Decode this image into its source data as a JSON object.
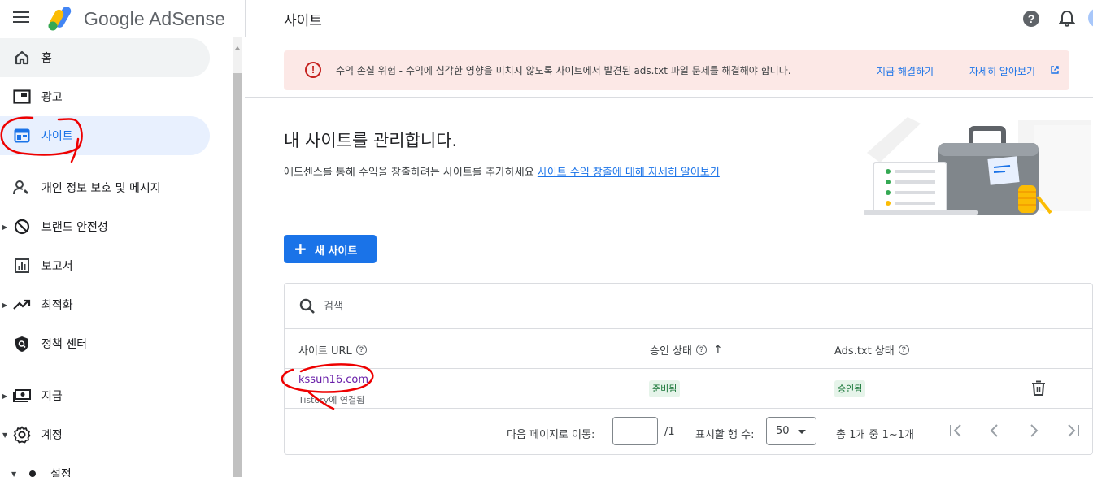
{
  "header": {
    "brand": "Google AdSense",
    "page_title": "사이트",
    "help_symbol": "?"
  },
  "sidebar": {
    "items": [
      {
        "label": "홈",
        "icon": "home-icon"
      },
      {
        "label": "광고",
        "icon": "ads-icon"
      },
      {
        "label": "사이트",
        "icon": "sites-icon",
        "active": true
      },
      {
        "label": "개인 정보 보호 및 메시지",
        "icon": "privacy-icon"
      },
      {
        "label": "브랜드 안전성",
        "icon": "brand-safety-icon"
      },
      {
        "label": "보고서",
        "icon": "reports-icon"
      },
      {
        "label": "최적화",
        "icon": "optimization-icon"
      },
      {
        "label": "정책 센터",
        "icon": "policy-icon"
      },
      {
        "label": "지급",
        "icon": "payments-icon"
      },
      {
        "label": "계정",
        "icon": "gear-icon"
      },
      {
        "label": "설정",
        "icon": "dot-icon"
      }
    ]
  },
  "alert": {
    "icon_symbol": "!",
    "message": "수익 손실 위험 - 수익에 심각한 영향을 미치지 않도록 사이트에서 발견된 ads.txt 파일 문제를 해결해야 합니다.",
    "fix_label": "지금 해결하기",
    "learn_label": "자세히 알아보기",
    "color": "#fce8e6"
  },
  "hero": {
    "title": "내 사이트를 관리합니다.",
    "subtitle": "애드센스를 통해 수익을 창출하려는 사이트를 추가하세요",
    "link": "사이트 수익 창출에 대해 자세히 알아보기"
  },
  "new_site_button": {
    "plus": "+",
    "label": "새 사이트"
  },
  "table": {
    "search_placeholder": "검색",
    "columns": [
      {
        "label": "사이트 URL"
      },
      {
        "label": "승인 상태"
      },
      {
        "label": "Ads.txt 상태"
      }
    ],
    "rows": [
      {
        "url": "kssun16.com",
        "subtitle": "Tistory에 연결됨",
        "approval": "준비됨",
        "ads_txt": "승인됨"
      }
    ],
    "help_symbol": "?",
    "sort_arrow": "↑"
  },
  "pagination": {
    "goto_label": "다음 페이지로 이동:",
    "page_value": "",
    "of_label": "/1",
    "rows_label": "표시할 행 수:",
    "rows_value": "50",
    "total_label": "총 1개 중 1~1개"
  },
  "colors": {
    "accent": "#1a73e8",
    "active_nav_bg": "#e8f0fe",
    "chip_bg": "#e6f4ea",
    "chip_text": "#137333",
    "error": "#c5221f"
  }
}
